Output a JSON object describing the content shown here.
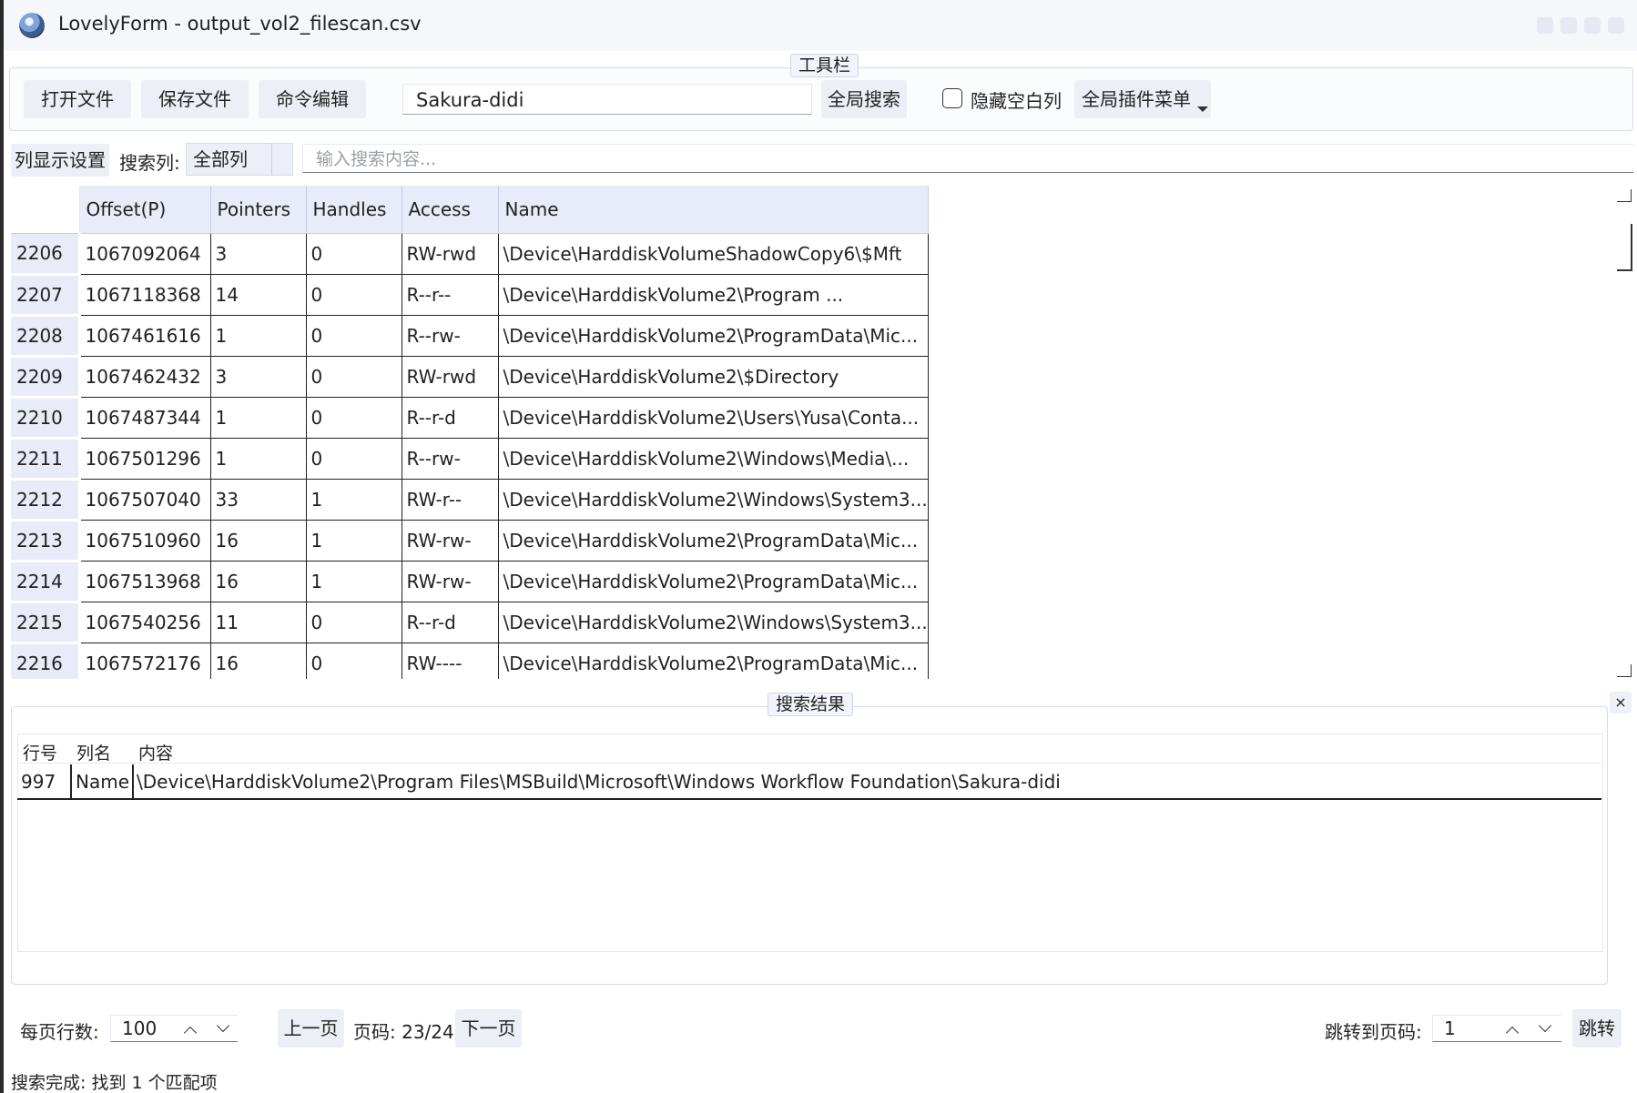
{
  "window": {
    "title": "LovelyForm - output_vol2_filescan.csv"
  },
  "toolbar": {
    "group_title": "工具栏",
    "open_file": "打开文件",
    "save_file": "保存文件",
    "command_edit": "命令编辑",
    "search_value": "Sakura-didi",
    "global_search": "全局搜索",
    "hide_empty_label": "隐藏空白列",
    "hide_empty_checked": false,
    "plugin_menu": "全局插件菜单"
  },
  "column_bar": {
    "column_settings": "列显示设置",
    "search_column_label": "搜索列:",
    "search_column_value": "全部列",
    "search_placeholder": "输入搜索内容..."
  },
  "table": {
    "columns": [
      "Offset(P)",
      "Pointers",
      "Handles",
      "Access",
      "Name"
    ],
    "rows": [
      {
        "row": "2206",
        "offset": "1067092064",
        "pointers": "3",
        "handles": "0",
        "access": "RW-rwd",
        "name": "\\Device\\HarddiskVolumeShadowCopy6\\$Mft"
      },
      {
        "row": "2207",
        "offset": "1067118368",
        "pointers": "14",
        "handles": "0",
        "access": "R--r--",
        "name": "\\Device\\HarddiskVolume2\\Program ..."
      },
      {
        "row": "2208",
        "offset": "1067461616",
        "pointers": "1",
        "handles": "0",
        "access": "R--rw-",
        "name": "\\Device\\HarddiskVolume2\\ProgramData\\Mic..."
      },
      {
        "row": "2209",
        "offset": "1067462432",
        "pointers": "3",
        "handles": "0",
        "access": "RW-rwd",
        "name": "\\Device\\HarddiskVolume2\\$Directory"
      },
      {
        "row": "2210",
        "offset": "1067487344",
        "pointers": "1",
        "handles": "0",
        "access": "R--r-d",
        "name": "\\Device\\HarddiskVolume2\\Users\\Yusa\\Conta..."
      },
      {
        "row": "2211",
        "offset": "1067501296",
        "pointers": "1",
        "handles": "0",
        "access": "R--rw-",
        "name": "\\Device\\HarddiskVolume2\\Windows\\Media\\..."
      },
      {
        "row": "2212",
        "offset": "1067507040",
        "pointers": "33",
        "handles": "1",
        "access": "RW-r--",
        "name": "\\Device\\HarddiskVolume2\\Windows\\System3..."
      },
      {
        "row": "2213",
        "offset": "1067510960",
        "pointers": "16",
        "handles": "1",
        "access": "RW-rw-",
        "name": "\\Device\\HarddiskVolume2\\ProgramData\\Mic..."
      },
      {
        "row": "2214",
        "offset": "1067513968",
        "pointers": "16",
        "handles": "1",
        "access": "RW-rw-",
        "name": "\\Device\\HarddiskVolume2\\ProgramData\\Mic..."
      },
      {
        "row": "2215",
        "offset": "1067540256",
        "pointers": "11",
        "handles": "0",
        "access": "R--r-d",
        "name": "\\Device\\HarddiskVolume2\\Windows\\System3..."
      },
      {
        "row": "2216",
        "offset": "1067572176",
        "pointers": "16",
        "handles": "0",
        "access": "RW----",
        "name": "\\Device\\HarddiskVolume2\\ProgramData\\Mic..."
      }
    ]
  },
  "results": {
    "group_title": "搜索结果",
    "close": "×",
    "headers": {
      "row": "行号",
      "column": "列名",
      "content": "内容"
    },
    "match": {
      "row": "997",
      "column": "Name",
      "content": "\\Device\\HarddiskVolume2\\Program Files\\MSBuild\\Microsoft\\Windows Workflow Foundation\\Sakura-didi"
    }
  },
  "paging": {
    "rows_per_page_label": "每页行数:",
    "rows_per_page_value": "100",
    "prev": "上一页",
    "page_info": "页码: 23/24",
    "next": "下一页",
    "goto_label": "跳转到页码:",
    "goto_value": "1",
    "goto_button": "跳转"
  },
  "status": "搜索完成: 找到 1 个匹配项"
}
